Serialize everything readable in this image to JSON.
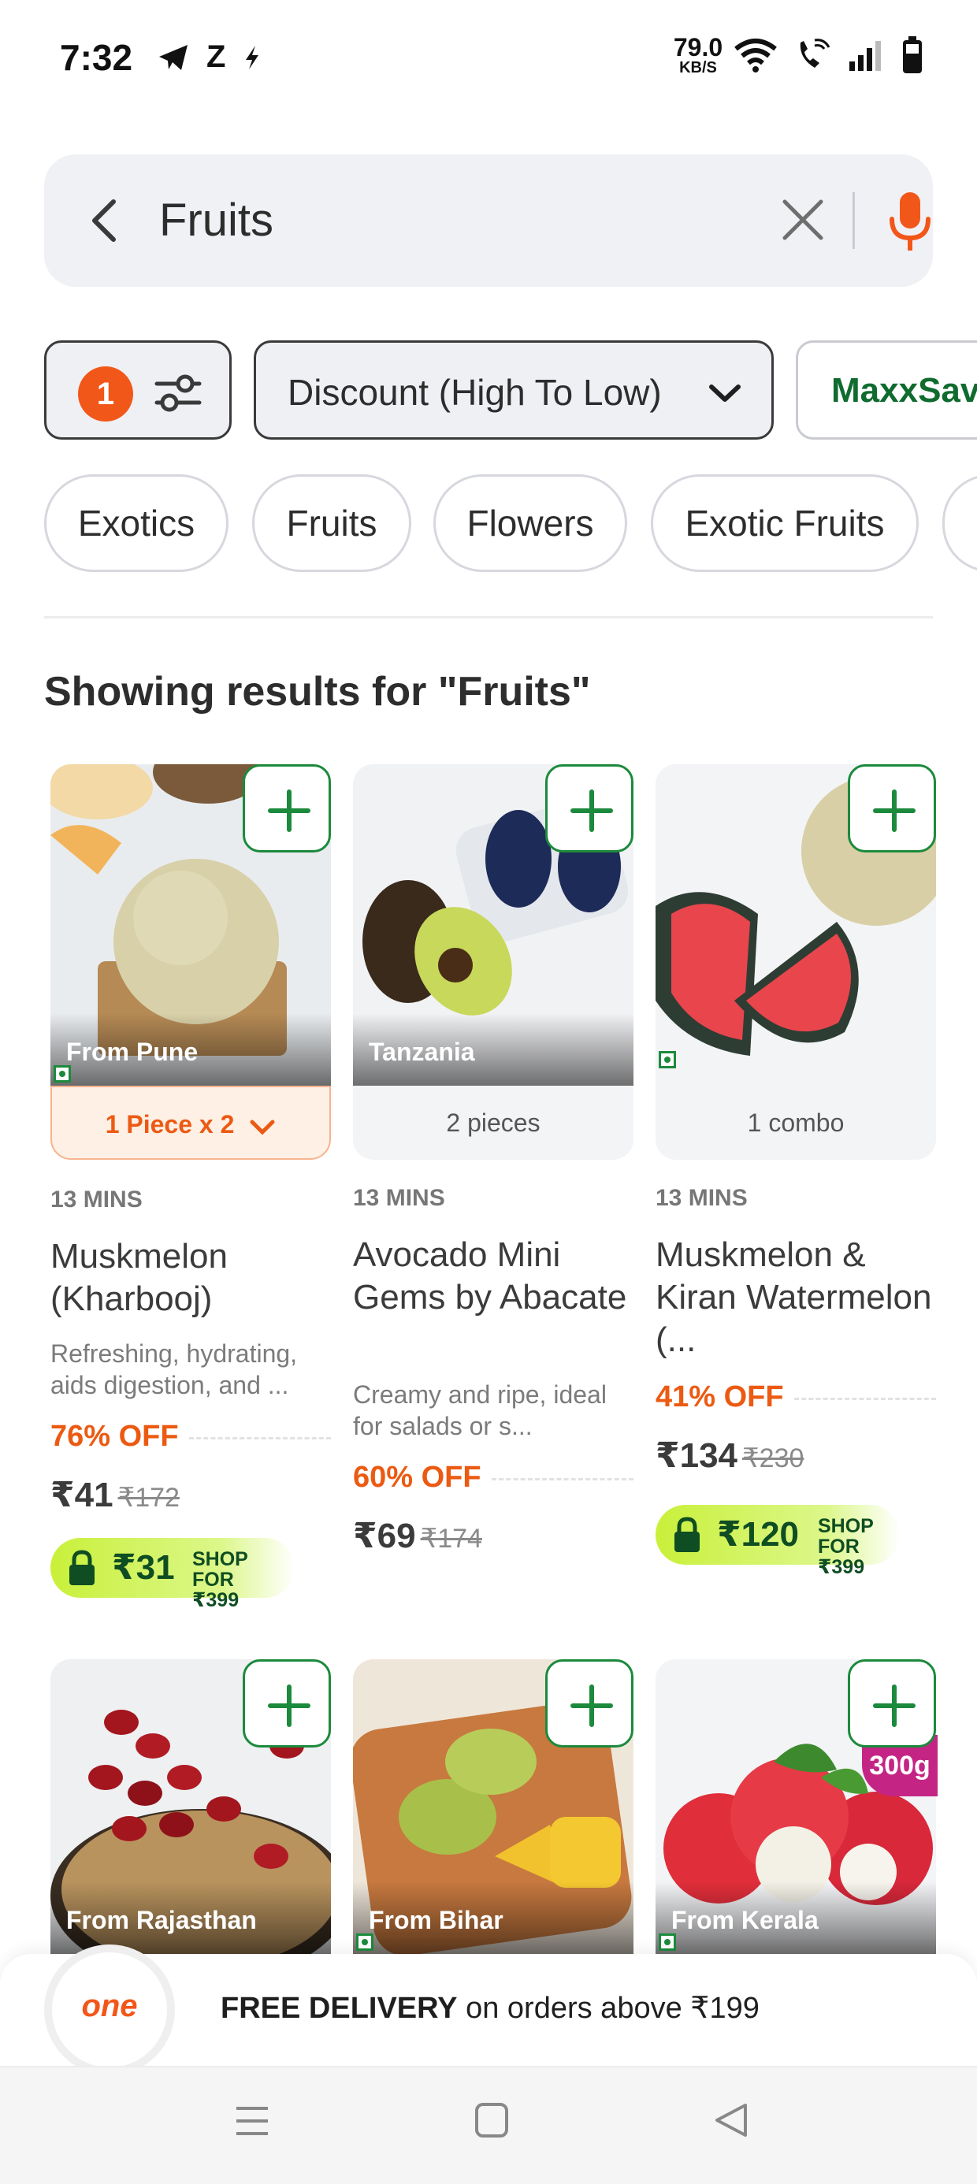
{
  "status_bar": {
    "time": "7:32",
    "left_icons": [
      "telegram-icon",
      "z-icon",
      "bolt-icon"
    ],
    "z_text": "Z",
    "speed_value": "79.0",
    "speed_unit": "KB/S"
  },
  "search": {
    "query": "Fruits"
  },
  "filters": {
    "active_count": "1",
    "sort_label": "Discount (High To Low)",
    "maxx_label": "MaxxSaver"
  },
  "chips": [
    "Exotics",
    "Fruits",
    "Flowers",
    "Exotic Fruits"
  ],
  "results_heading": "Showing results for \"Fruits\"",
  "products": [
    {
      "origin": "From Pune",
      "pack": "1 Piece x 2",
      "eta": "13 MINS",
      "name": "Muskmelon (Kharbooj)",
      "desc": "Refreshing, hydrating, aids digestion, and ...",
      "discount": "76% OFF",
      "price": "₹41",
      "mrp": "₹172",
      "shop_price": "₹31",
      "shop_for": "SHOP FOR",
      "shop_amount": "₹399"
    },
    {
      "origin": "Tanzania",
      "pack": "2 pieces",
      "eta": "13 MINS",
      "name": "Avocado Mini Gems by Abacate",
      "desc": "Creamy and ripe, ideal for salads or s...",
      "discount": "60% OFF",
      "price": "₹69",
      "mrp": "₹174"
    },
    {
      "origin": "",
      "pack": "1 combo",
      "eta": "13 MINS",
      "name": "Muskmelon & Kiran Watermelon (...",
      "desc": "",
      "discount": "41% OFF",
      "price": "₹134",
      "mrp": "₹230",
      "shop_price": "₹120",
      "shop_for": "SHOP FOR",
      "shop_amount": "₹399"
    },
    {
      "origin": "From Rajasthan"
    },
    {
      "origin": "From Bihar"
    },
    {
      "origin": "From Kerala",
      "weight_badge": "300g"
    }
  ],
  "banner": {
    "brand": "one",
    "bold": "FREE DELIVERY",
    "rest": " on orders above ₹199"
  },
  "colors": {
    "accent_orange": "#f2571a",
    "green": "#1c8a3c",
    "lime": "#c9f03a"
  }
}
